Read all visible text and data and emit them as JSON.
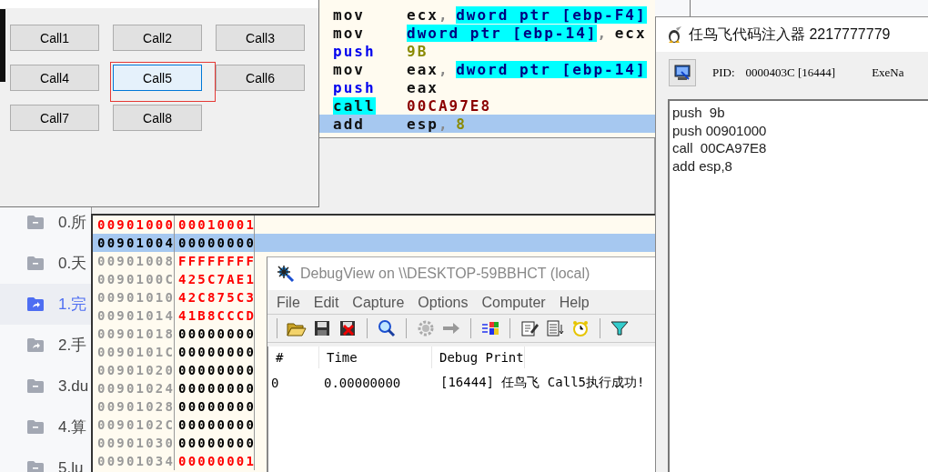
{
  "sidebar": {
    "items": [
      {
        "label": "0.所",
        "kind": "folder",
        "selected": false
      },
      {
        "label": "0.天",
        "kind": "folder",
        "selected": false
      },
      {
        "label": "1.完",
        "kind": "shared",
        "selected": true
      },
      {
        "label": "2.手",
        "kind": "shared",
        "selected": false
      },
      {
        "label": "3.du",
        "kind": "folder",
        "selected": false
      },
      {
        "label": "4.算",
        "kind": "folder",
        "selected": false
      },
      {
        "label": "5.lu",
        "kind": "folder",
        "selected": false
      }
    ]
  },
  "call_window": {
    "buttons": [
      {
        "label": "Call1",
        "focused": false,
        "outlined": false
      },
      {
        "label": "Call2",
        "focused": false,
        "outlined": false
      },
      {
        "label": "Call3",
        "focused": false,
        "outlined": false
      },
      {
        "label": "Call4",
        "focused": false,
        "outlined": false
      },
      {
        "label": "Call5",
        "focused": true,
        "outlined": true
      },
      {
        "label": "Call6",
        "focused": false,
        "outlined": false
      },
      {
        "label": "Call7",
        "focused": false,
        "outlined": false
      },
      {
        "label": "Call8",
        "focused": false,
        "outlined": false
      }
    ]
  },
  "disassembly": {
    "rows": [
      {
        "mnemonic": "mov",
        "kind": "plain",
        "selected": false,
        "operand": [
          {
            "text": "ecx",
            "kind": "reg"
          },
          {
            "text": ", ",
            "kind": "sep"
          },
          {
            "text": "dword ptr [ebp-F4]",
            "kind": "mem"
          }
        ]
      },
      {
        "mnemonic": "mov",
        "kind": "plain",
        "selected": false,
        "operand": [
          {
            "text": "dword ptr [ebp-14]",
            "kind": "mem"
          },
          {
            "text": ", ",
            "kind": "sep"
          },
          {
            "text": "ecx",
            "kind": "reg"
          }
        ]
      },
      {
        "mnemonic": "push",
        "kind": "push",
        "selected": false,
        "operand": [
          {
            "text": "9B",
            "kind": "imm"
          }
        ]
      },
      {
        "mnemonic": "mov",
        "kind": "plain",
        "selected": false,
        "operand": [
          {
            "text": "eax",
            "kind": "reg"
          },
          {
            "text": ", ",
            "kind": "sep"
          },
          {
            "text": "dword ptr [ebp-14]",
            "kind": "mem"
          }
        ]
      },
      {
        "mnemonic": "push",
        "kind": "push",
        "selected": false,
        "operand": [
          {
            "text": "eax",
            "kind": "reg"
          }
        ]
      },
      {
        "mnemonic": "call",
        "kind": "call",
        "selected": false,
        "operand": [
          {
            "text": "00CA97E8",
            "kind": "addr"
          }
        ]
      },
      {
        "mnemonic": "add",
        "kind": "plain",
        "selected": true,
        "operand": [
          {
            "text": "esp",
            "kind": "reg"
          },
          {
            "text": ", ",
            "kind": "sep"
          },
          {
            "text": "8",
            "kind": "imm"
          }
        ]
      }
    ]
  },
  "memory": {
    "rows": [
      {
        "address": "00901000",
        "value": "00010001",
        "address_changed": true,
        "value_changed": true,
        "selected": false
      },
      {
        "address": "00901004",
        "value": "00000000",
        "address_changed": false,
        "value_changed": false,
        "selected": true
      },
      {
        "address": "00901008",
        "value": "FFFFFFFF",
        "address_changed": false,
        "value_changed": true,
        "selected": false
      },
      {
        "address": "0090100C",
        "value": "425C7AE1",
        "address_changed": false,
        "value_changed": true,
        "selected": false
      },
      {
        "address": "00901010",
        "value": "42C875C3",
        "address_changed": false,
        "value_changed": true,
        "selected": false
      },
      {
        "address": "00901014",
        "value": "41B8CCCD",
        "address_changed": false,
        "value_changed": true,
        "selected": false
      },
      {
        "address": "00901018",
        "value": "00000000",
        "address_changed": false,
        "value_changed": false,
        "selected": false
      },
      {
        "address": "0090101C",
        "value": "00000000",
        "address_changed": false,
        "value_changed": false,
        "selected": false
      },
      {
        "address": "00901020",
        "value": "00000000",
        "address_changed": false,
        "value_changed": false,
        "selected": false
      },
      {
        "address": "00901024",
        "value": "00000000",
        "address_changed": false,
        "value_changed": false,
        "selected": false
      },
      {
        "address": "00901028",
        "value": "00000000",
        "address_changed": false,
        "value_changed": false,
        "selected": false
      },
      {
        "address": "0090102C",
        "value": "00000000",
        "address_changed": false,
        "value_changed": false,
        "selected": false
      },
      {
        "address": "00901030",
        "value": "00000000",
        "address_changed": false,
        "value_changed": false,
        "selected": false
      },
      {
        "address": "00901034",
        "value": "00000001",
        "address_changed": false,
        "value_changed": true,
        "selected": false
      }
    ]
  },
  "debugview": {
    "window": {
      "title": "DebugView on \\\\DESKTOP-59BBHCT (local)"
    },
    "menu": [
      "File",
      "Edit",
      "Capture",
      "Options",
      "Computer",
      "Help"
    ],
    "table": {
      "columns": [
        "#",
        "Time",
        "Debug Print"
      ],
      "rows": [
        {
          "index": "0",
          "time": "0.00000000",
          "print": "[16444] 任鸟飞 Call5执行成功!"
        }
      ]
    }
  },
  "injector": {
    "window": {
      "title": "任鸟飞代码注入器 2217777779"
    },
    "pid_label": "PID:",
    "pid": "0000403C [16444]",
    "exe_label": "ExeNa",
    "code": [
      "push  9b",
      "push 00901000",
      "call  00CA97E8",
      "add esp,8"
    ]
  }
}
